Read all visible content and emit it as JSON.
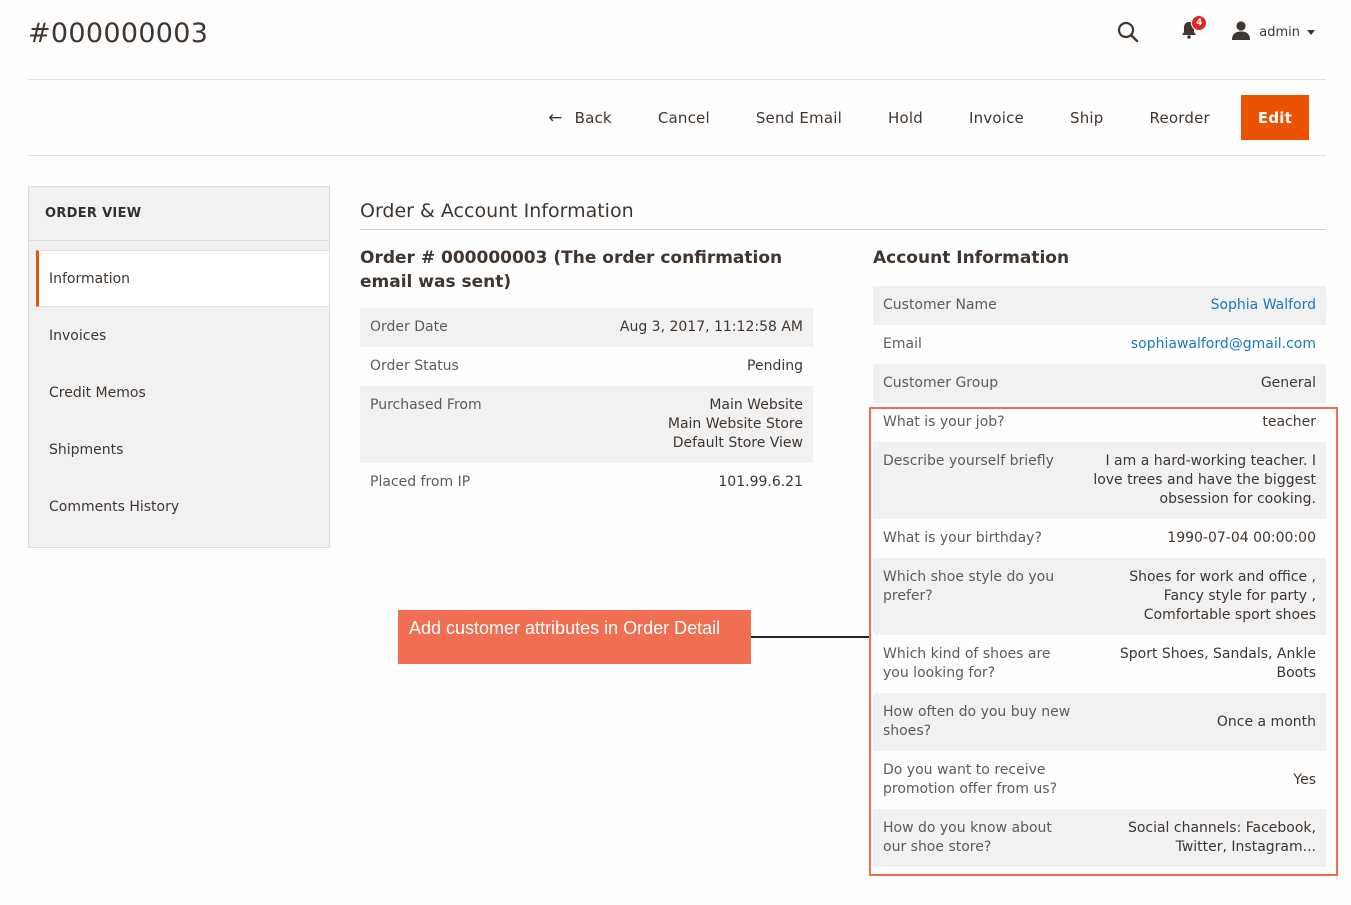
{
  "page": {
    "title": "#000000003"
  },
  "header": {
    "search_icon": "search-icon",
    "notifications": {
      "icon": "bell-icon",
      "count": "4"
    },
    "user": {
      "icon": "user-icon",
      "name": "admin"
    }
  },
  "actions": {
    "back": "Back",
    "cancel": "Cancel",
    "send_email": "Send Email",
    "hold": "Hold",
    "invoice": "Invoice",
    "ship": "Ship",
    "reorder": "Reorder",
    "edit": "Edit"
  },
  "sidebar": {
    "title": "ORDER VIEW",
    "items": [
      {
        "label": "Information",
        "active": true
      },
      {
        "label": "Invoices"
      },
      {
        "label": "Credit Memos"
      },
      {
        "label": "Shipments"
      },
      {
        "label": "Comments History"
      }
    ]
  },
  "main": {
    "section_title": "Order & Account Information",
    "order": {
      "heading": "Order # 000000003 (The order confirmation email was sent)",
      "rows": [
        {
          "label": "Order Date",
          "value": "Aug 3, 2017, 11:12:58 AM"
        },
        {
          "label": "Order Status",
          "value": "Pending"
        },
        {
          "label": "Purchased From",
          "value_lines": [
            "Main Website",
            "Main Website Store",
            "Default Store View"
          ]
        },
        {
          "label": "Placed from IP",
          "value": "101.99.6.21"
        }
      ]
    },
    "account": {
      "heading": "Account Information",
      "rows": [
        {
          "label": "Customer Name",
          "value": "Sophia Walford",
          "link": true
        },
        {
          "label": "Email",
          "value": "sophiawalford@gmail.com",
          "link": true
        },
        {
          "label": "Customer Group",
          "value": "General"
        },
        {
          "label": "What is your job?",
          "value": "teacher"
        },
        {
          "label": "Describe yourself briefly",
          "value": "I am a hard-working teacher. I love trees and have the biggest obsession for cooking."
        },
        {
          "label": "What is your birthday?",
          "value": "1990-07-04 00:00:00"
        },
        {
          "label": "Which shoe style do you prefer?",
          "value": "Shoes for work and office , Fancy style for party , Comfortable sport shoes"
        },
        {
          "label": "Which kind of shoes are you looking for?",
          "value": "Sport Shoes, Sandals, Ankle Boots"
        },
        {
          "label": "How often do you buy new shoes?",
          "value": "Once a month"
        },
        {
          "label": "Do you want to receive promotion offer from us?",
          "value": "Yes"
        },
        {
          "label": "How do you know about our shoe store?",
          "value": "Social channels: Facebook, Twitter, Instagram..."
        }
      ]
    }
  },
  "annotation": {
    "callout_text": "Add customer attributes in Order Detail"
  },
  "colors": {
    "accent": "#eb5202",
    "link": "#1979c3",
    "annotation": "#f06e51",
    "badge": "#e22626"
  }
}
